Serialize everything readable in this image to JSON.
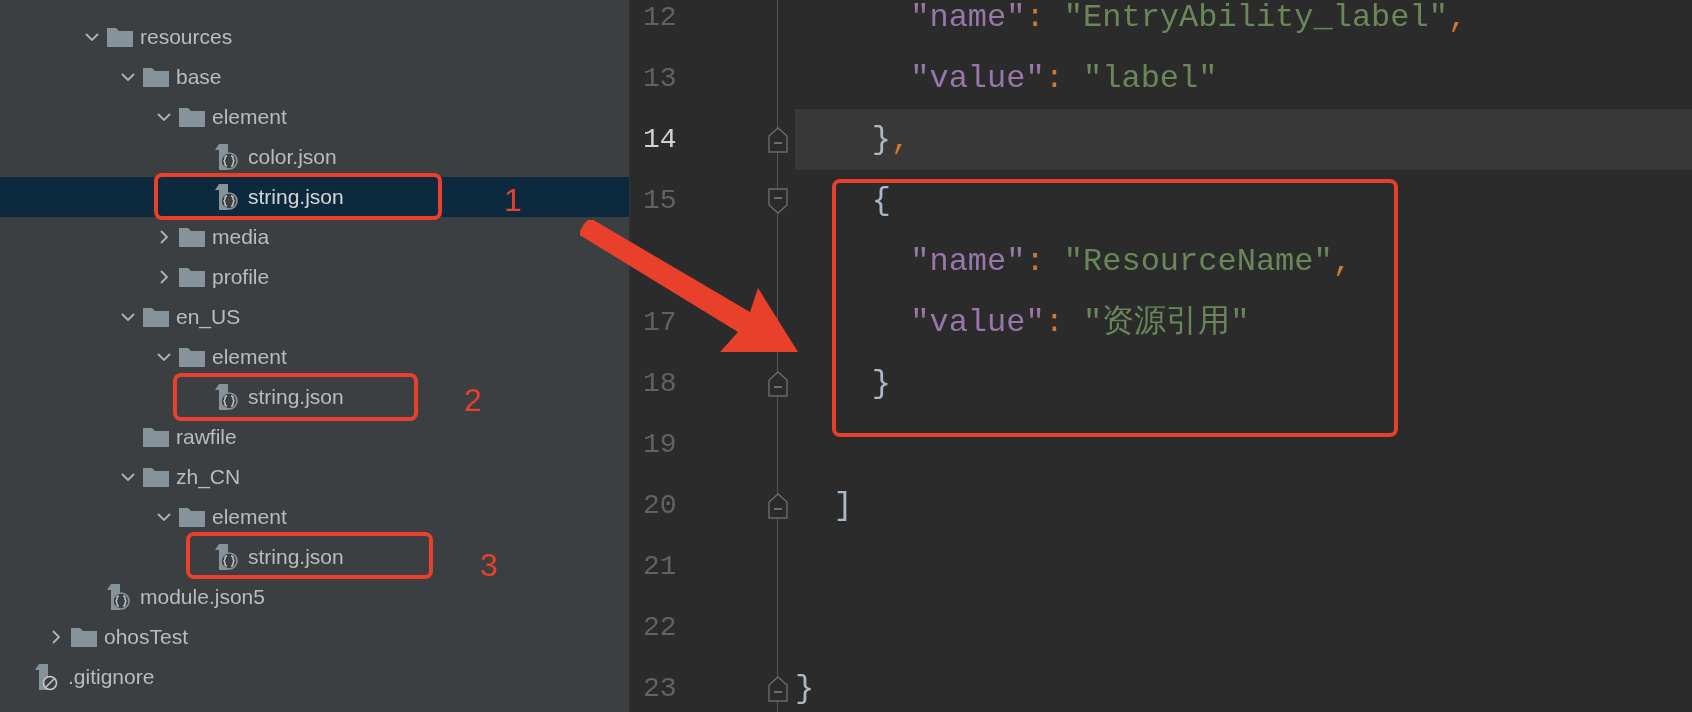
{
  "project_tree": [
    {
      "children": [
        {
          "children": [
            {
              "children": [
                {
                  "label": "resources",
                  "kind": "folder",
                  "expanded": true,
                  "selected": false,
                  "children": [
                    {
                      "label": "base",
                      "kind": "folder",
                      "expanded": true,
                      "selected": false,
                      "children": [
                        {
                          "label": "element",
                          "kind": "folder",
                          "expanded": true,
                          "selected": false,
                          "children": [
                            {
                              "label": "color.json",
                              "kind": "json_file",
                              "selected": false
                            },
                            {
                              "label": "string.json",
                              "kind": "json_file",
                              "selected": true
                            }
                          ]
                        },
                        {
                          "label": "media",
                          "kind": "folder",
                          "expanded": false,
                          "selected": false
                        },
                        {
                          "label": "profile",
                          "kind": "folder",
                          "expanded": false,
                          "selected": false
                        }
                      ]
                    },
                    {
                      "label": "en_US",
                      "kind": "folder",
                      "expanded": true,
                      "selected": false,
                      "children": [
                        {
                          "label": "element",
                          "kind": "folder",
                          "expanded": true,
                          "selected": false,
                          "children": [
                            {
                              "label": "string.json",
                              "kind": "json_file",
                              "selected": false
                            }
                          ]
                        }
                      ]
                    },
                    {
                      "label": "rawfile",
                      "kind": "folder",
                      "selected": false
                    },
                    {
                      "label": "zh_CN",
                      "kind": "folder",
                      "expanded": true,
                      "selected": false,
                      "children": [
                        {
                          "label": "element",
                          "kind": "folder",
                          "expanded": true,
                          "selected": false,
                          "children": [
                            {
                              "label": "string.json",
                              "kind": "json_file",
                              "selected": false
                            }
                          ]
                        }
                      ]
                    }
                  ]
                },
                {
                  "label": "module.json5",
                  "kind": "json_file",
                  "selected": false
                }
              ]
            },
            {
              "label": "ohosTest",
              "kind": "folder",
              "expanded": false,
              "selected": false
            }
          ]
        },
        {
          "label": ".gitignore",
          "kind": "ignore_file",
          "selected": false
        }
      ]
    }
  ],
  "editor": {
    "lines": [
      {
        "number": "12",
        "current": false,
        "kind": "plain",
        "tokens": [
          {
            "kind": "key",
            "text": "      \"name\""
          },
          {
            "kind": "punct",
            "text": ": "
          },
          {
            "kind": "string",
            "text": "\"EntryAbility_label\""
          },
          {
            "kind": "punct",
            "text": ","
          }
        ]
      },
      {
        "number": "13",
        "current": false,
        "kind": "plain",
        "tokens": [
          {
            "kind": "key",
            "text": "      \"value\""
          },
          {
            "kind": "punct",
            "text": ": "
          },
          {
            "kind": "string",
            "text": "\"label\""
          }
        ]
      },
      {
        "number": "14",
        "current": true,
        "kind": "fold_end",
        "tokens": [
          {
            "kind": "brace",
            "text": "    }"
          },
          {
            "kind": "punct",
            "text": ","
          }
        ]
      },
      {
        "number": "15",
        "current": false,
        "kind": "fold_start",
        "tokens": [
          {
            "kind": "brace",
            "text": "    {"
          }
        ]
      },
      {
        "current": false,
        "kind": "plain",
        "tokens": [
          {
            "kind": "key",
            "text": "      \"name\""
          },
          {
            "kind": "punct",
            "text": ": "
          },
          {
            "kind": "string",
            "text": "\"ResourceName\""
          },
          {
            "kind": "punct",
            "text": ","
          }
        ]
      },
      {
        "number": "17",
        "current": false,
        "kind": "plain",
        "tokens": [
          {
            "kind": "key",
            "text": "      \"value\""
          },
          {
            "kind": "punct",
            "text": ": "
          },
          {
            "kind": "string",
            "text": "\"资源引用\""
          }
        ]
      },
      {
        "number": "18",
        "current": false,
        "kind": "fold_end",
        "tokens": [
          {
            "kind": "brace",
            "text": "    }"
          }
        ]
      },
      {
        "number": "19",
        "current": false,
        "kind": "plain"
      },
      {
        "number": "20",
        "current": false,
        "kind": "fold_end",
        "tokens": [
          {
            "kind": "brace",
            "text": "  ]"
          }
        ]
      },
      {
        "number": "21",
        "current": false,
        "kind": "plain"
      },
      {
        "number": "22",
        "current": false,
        "kind": "plain"
      },
      {
        "number": "23",
        "current": false,
        "kind": "fold_end",
        "tokens": [
          {
            "kind": "brace",
            "text": "}"
          }
        ]
      }
    ]
  },
  "callouts": [
    "1",
    "2",
    "3"
  ]
}
